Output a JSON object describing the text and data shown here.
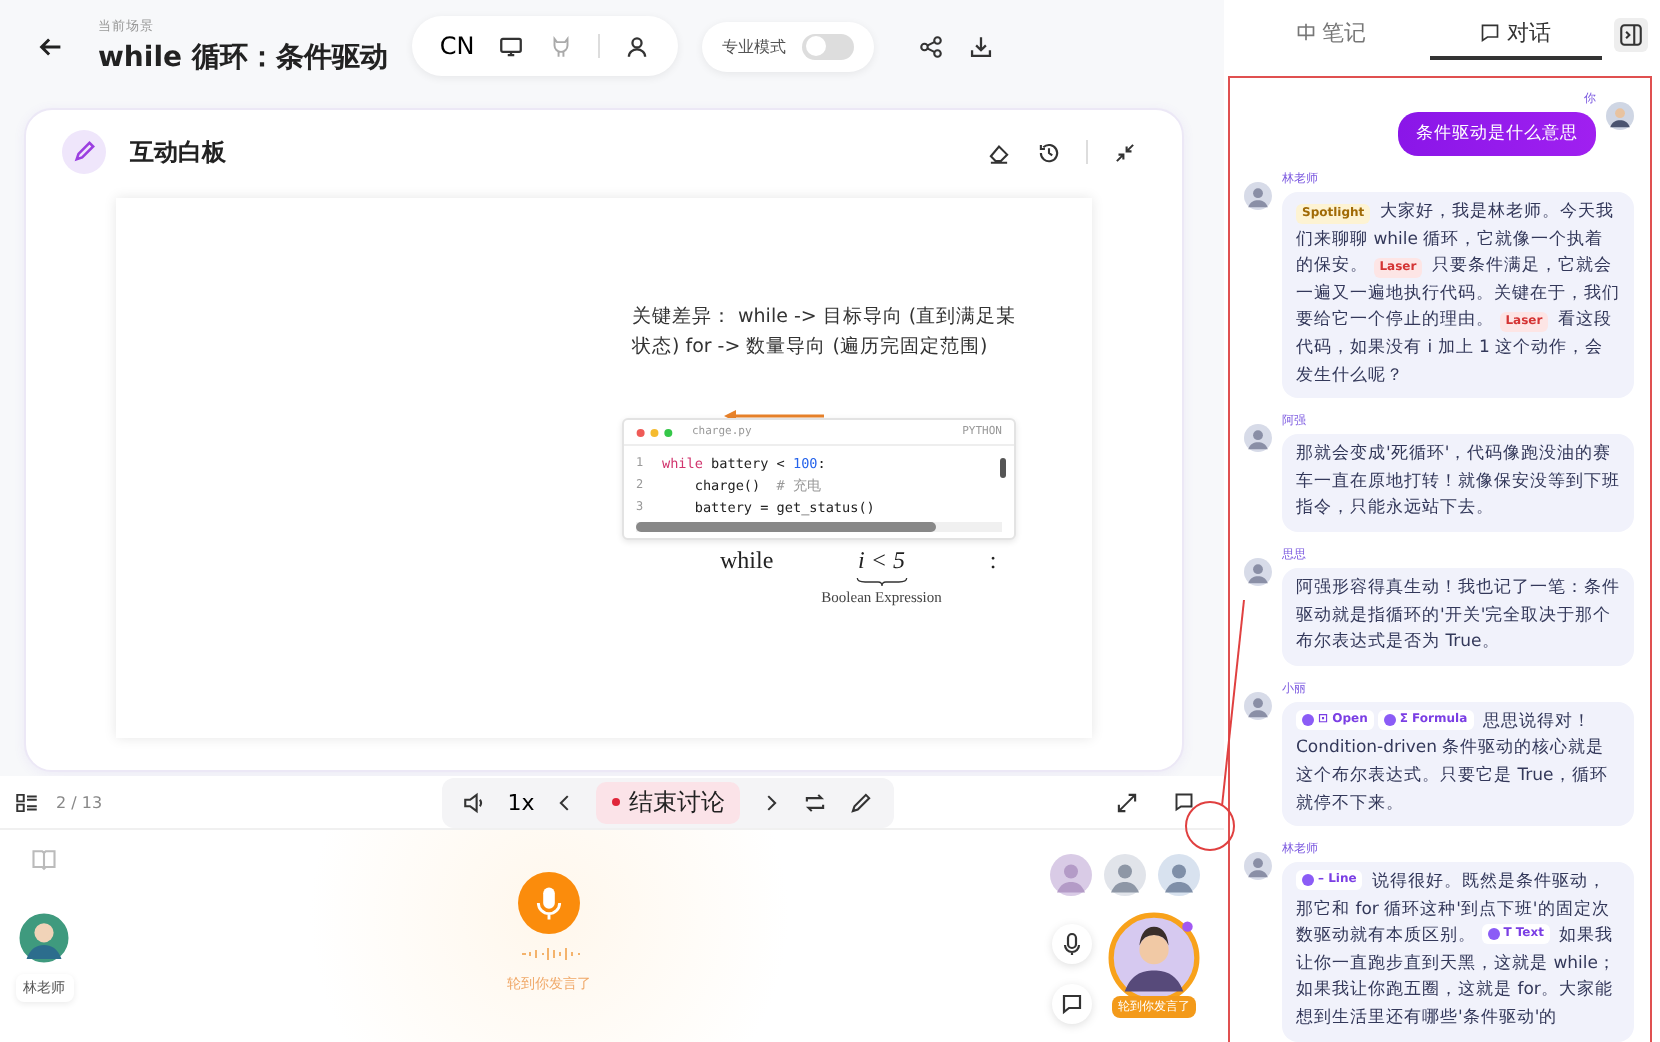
{
  "header": {
    "breadcrumb": "当前场景",
    "title": "while 循环：条件驱动",
    "language": "CN",
    "pro_mode": {
      "label": "专业模式",
      "on": false
    }
  },
  "whiteboard": {
    "title": "互动白板",
    "slide": {
      "note": "关键差异： while -> 目标导向 (直到满足某状态) for -> 数量导向 (遍历完固定范围)",
      "code": {
        "filename": "charge.py",
        "language": "PYTHON",
        "lines": [
          {
            "number": "1",
            "tokens": [
              {
                "kind": "keyword",
                "text": "while"
              },
              {
                "kind": "plain",
                "text": " battery < "
              },
              {
                "kind": "number",
                "text": "100"
              },
              {
                "kind": "plain",
                "text": ":"
              }
            ]
          },
          {
            "number": "2",
            "tokens": [
              {
                "kind": "plain",
                "text": "    charge()  "
              },
              {
                "kind": "comment",
                "text": "# 充电"
              }
            ]
          },
          {
            "number": "3",
            "tokens": [
              {
                "kind": "plain",
                "text": "    battery = get_status()"
              }
            ]
          }
        ]
      },
      "formula": {
        "keyword": "while",
        "condition": "i < 5",
        "colon": ":",
        "caption": "Boolean Expression"
      }
    }
  },
  "toolbar": {
    "page": "2 / 13",
    "speed": "1x",
    "end_button": "结束讨论"
  },
  "stage": {
    "teacher": "林老师",
    "prompt": "轮到你发言了",
    "user_badge": "轮到你发言了"
  },
  "side_tabs": [
    {
      "kind": "notes",
      "label": "笔记",
      "selected": false
    },
    {
      "kind": "chat",
      "label": "对话",
      "selected": true
    }
  ],
  "messages": [
    {
      "from_me": true,
      "sender": "你",
      "parts": [
        {
          "kind": "text",
          "text": "条件驱动是什么意思"
        }
      ]
    },
    {
      "from_me": false,
      "sender": "林老师",
      "parts": [
        {
          "kind": "spotlight",
          "text": "Spotlight"
        },
        {
          "kind": "text",
          "text": " 大家好，我是林老师。今天我们来聊聊 while 循环，它就像一个执着的保安。 "
        },
        {
          "kind": "laser",
          "text": "Laser"
        },
        {
          "kind": "text",
          "text": " 只要条件满足，它就会一遍又一遍地执行代码。关键在于，我们要给它一个停止的理由。 "
        },
        {
          "kind": "laser",
          "text": "Laser"
        },
        {
          "kind": "text",
          "text": " 看这段代码，如果没有 i 加上 1 这个动作，会发生什么呢？"
        }
      ]
    },
    {
      "from_me": false,
      "sender": "阿强",
      "parts": [
        {
          "kind": "text",
          "text": "那就会变成'死循环'，代码像跑没油的赛车一直在原地打转！就像保安没等到下班指令，只能永远站下去。"
        }
      ]
    },
    {
      "from_me": false,
      "sender": "思思",
      "parts": [
        {
          "kind": "text",
          "text": "阿强形容得真生动！我也记了一笔：条件驱动就是指循环的'开关'完全取决于那个布尔表达式是否为 True。"
        }
      ]
    },
    {
      "from_me": false,
      "sender": "小丽",
      "parts": [
        {
          "kind": "action",
          "text": "⊡ Open"
        },
        {
          "kind": "action",
          "text": "Σ Formula"
        },
        {
          "kind": "text",
          "text": " 思思说得对！Condition-driven 条件驱动的核心就是这个布尔表达式。只要它是 True，循环就停不下来。"
        }
      ]
    },
    {
      "from_me": false,
      "sender": "林老师",
      "parts": [
        {
          "kind": "action",
          "text": "– Line"
        },
        {
          "kind": "text",
          "text": " 说得很好。既然是条件驱动，那它和 for 循环这种'到点下班'的固定次数驱动就有本质区别。 "
        },
        {
          "kind": "action",
          "text": "T Text"
        },
        {
          "kind": "text",
          "text": " 如果我让你一直跑步直到天黑，这就是 while；如果我让你跑五圈，这就是 for。大家能想到生活里还有哪些'条件驱动'的"
        }
      ]
    }
  ]
}
